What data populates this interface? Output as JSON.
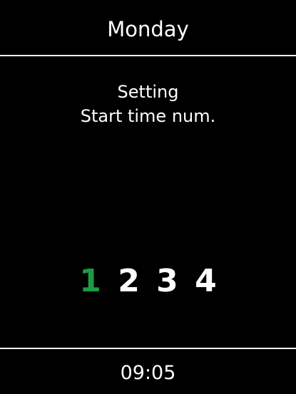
{
  "header": {
    "title": "Monday"
  },
  "main": {
    "line1": "Setting",
    "line2": "Start time num.",
    "numbers": [
      "1",
      "2",
      "3",
      "4"
    ],
    "selected_index": 0
  },
  "footer": {
    "time": "09:05"
  },
  "colors": {
    "background": "#000000",
    "text": "#ffffff",
    "accent": "#1e9a45"
  }
}
